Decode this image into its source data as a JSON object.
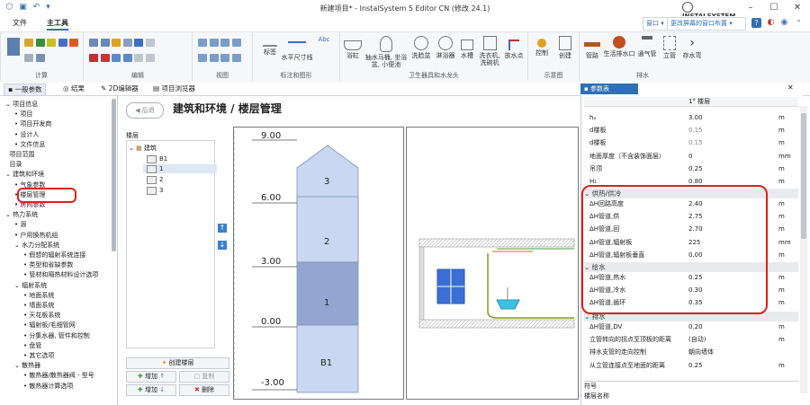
{
  "window": {
    "title": "新建项目* - InstalSystem 5 Editor CN (修改 24.1)",
    "brand": "INSTALSYSTEM"
  },
  "menu": {
    "file": "文件",
    "tools": "主工具"
  },
  "topright": {
    "window": "窗口",
    "layout": "更改屏幕的窗口布置"
  },
  "ribbon": {
    "groups": [
      {
        "label": "计算"
      },
      {
        "label": "编辑"
      },
      {
        "label": "视图"
      },
      {
        "label": "标注和图形"
      },
      {
        "label": "卫生器具和水龙头"
      },
      {
        "label": "示意图"
      },
      {
        "label": "排水"
      }
    ],
    "buttons": {
      "annot": "标签",
      "hdim": "水平尺寸线",
      "text": "Abc",
      "bathtub": "浴缸",
      "toilet": "抽水马桶, 坐浴盆, 小便池",
      "basin": "洗脸盆",
      "shower": "淋浴器",
      "sink": "水槽",
      "washer": "洗衣机, 洗碗机",
      "tap": "放水点",
      "control": "控制",
      "create": "创建",
      "pipe": "管路",
      "drain": "生活排水口",
      "vent": "通气管",
      "stack": "立管",
      "trap": "存水弯"
    }
  },
  "tabs": [
    "一般参数",
    "结果",
    "2D编辑器",
    "项目浏览器"
  ],
  "tree": [
    {
      "label": "项目信息",
      "level": 0,
      "kind": "folder"
    },
    {
      "label": "项目",
      "level": 1,
      "kind": "bullet"
    },
    {
      "label": "项目开发商",
      "level": 1,
      "kind": "bullet"
    },
    {
      "label": "设计人",
      "level": 1,
      "kind": "bullet"
    },
    {
      "label": "文件信息",
      "level": 1,
      "kind": "bullet"
    },
    {
      "label": "项目范围",
      "level": 0,
      "kind": "item"
    },
    {
      "label": "目录",
      "level": 0,
      "kind": "item"
    },
    {
      "label": "建筑和环境",
      "level": 0,
      "kind": "folder"
    },
    {
      "label": "气象参数",
      "level": 1,
      "kind": "bullet"
    },
    {
      "label": "楼层管理",
      "level": 1,
      "kind": "bullet"
    },
    {
      "label": "房间参数",
      "level": 1,
      "kind": "bullet"
    },
    {
      "label": "热力系统",
      "level": 0,
      "kind": "folder"
    },
    {
      "label": "源",
      "level": 1,
      "kind": "bullet"
    },
    {
      "label": "户用换热机组",
      "level": 1,
      "kind": "bullet"
    },
    {
      "label": "水力分配系统",
      "level": 1,
      "kind": "folder"
    },
    {
      "label": "假想的辐射系统连接",
      "level": 2,
      "kind": "bullet"
    },
    {
      "label": "类型和省缺参数",
      "level": 2,
      "kind": "bullet"
    },
    {
      "label": "管材和隔热材料设计选项",
      "level": 2,
      "kind": "bullet"
    },
    {
      "label": "辐射系统",
      "level": 1,
      "kind": "folder"
    },
    {
      "label": "地面系统",
      "level": 2,
      "kind": "bullet"
    },
    {
      "label": "墙面系统",
      "level": 2,
      "kind": "bullet"
    },
    {
      "label": "天花板系统",
      "level": 2,
      "kind": "bullet"
    },
    {
      "label": "辐射板/毛细管网",
      "level": 2,
      "kind": "bullet"
    },
    {
      "label": "分集水器, 管件和控制",
      "level": 2,
      "kind": "bullet"
    },
    {
      "label": "盘管",
      "level": 2,
      "kind": "bullet"
    },
    {
      "label": "其它选项",
      "level": 2,
      "kind": "bullet"
    },
    {
      "label": "散热器",
      "level": 1,
      "kind": "folder"
    },
    {
      "label": "散热器/散热器阀 - 型号",
      "level": 2,
      "kind": "bullet"
    },
    {
      "label": "散热器计算选项",
      "level": 2,
      "kind": "bullet"
    }
  ],
  "page": {
    "back": "后退",
    "title": "建筑和环境 / 楼层管理",
    "floors_label": "楼层",
    "building": "建筑",
    "floors": [
      "B1",
      "1",
      "2",
      "3"
    ],
    "create_floor": "创建楼层",
    "add": "增加",
    "copy": "复制",
    "delete": "删除"
  },
  "diagram": {
    "levels": [
      "9.00",
      "6.00",
      "3.00",
      "0.00",
      "-3.00"
    ],
    "blocks": [
      "3",
      "2",
      "1",
      "B1"
    ]
  },
  "props": {
    "tab": "参数表",
    "col_header": "1° 楼层",
    "top_rows": [
      {
        "name": "hₐ",
        "value": "3.00",
        "unit": "m"
      },
      {
        "name": "d楼板",
        "value": "0.15",
        "unit": "m"
      },
      {
        "name": "d楼板",
        "value": "0.15",
        "unit": "m"
      },
      {
        "name": "地面厚度（不含装饰面层）",
        "value": "0",
        "unit": "mm"
      },
      {
        "name": "吊顶",
        "value": "0.25",
        "unit": "m"
      },
      {
        "name": "H₁",
        "value": "0.80",
        "unit": "m"
      }
    ],
    "heating_title": "供热/供冷",
    "heating_rows": [
      {
        "name": "ΔH回路高度",
        "value": "2.40",
        "unit": "m"
      },
      {
        "name": "ΔH管道,供",
        "value": "2.75",
        "unit": "m"
      },
      {
        "name": "ΔH管道,回",
        "value": "2.70",
        "unit": "m"
      },
      {
        "name": "ΔH管道,辐射板",
        "value": "225",
        "unit": "mm"
      },
      {
        "name": "ΔH管道,辐射板垂直",
        "value": "0.00",
        "unit": "m"
      }
    ],
    "water_title": "给水",
    "water_rows": [
      {
        "name": "ΔH管道,热水",
        "value": "0.25",
        "unit": "m"
      },
      {
        "name": "ΔH管道,冷水",
        "value": "0.30",
        "unit": "m"
      },
      {
        "name": "ΔH管道,循环",
        "value": "0.35",
        "unit": "m"
      }
    ],
    "drain_title": "排水",
    "drain_rows": [
      {
        "name": "ΔH管道,DV",
        "value": "0.20",
        "unit": "m"
      },
      {
        "name": "立管转向的拐点至顶板的距离",
        "value": "(自动)",
        "unit": "m"
      },
      {
        "name": "排水支管的走向控制",
        "value": "朝向墙体",
        "unit": ""
      },
      {
        "name": "从立管连接点至地面的距离",
        "value": "0.25",
        "unit": "m"
      }
    ],
    "footer": [
      "符号",
      "楼层名称"
    ]
  }
}
